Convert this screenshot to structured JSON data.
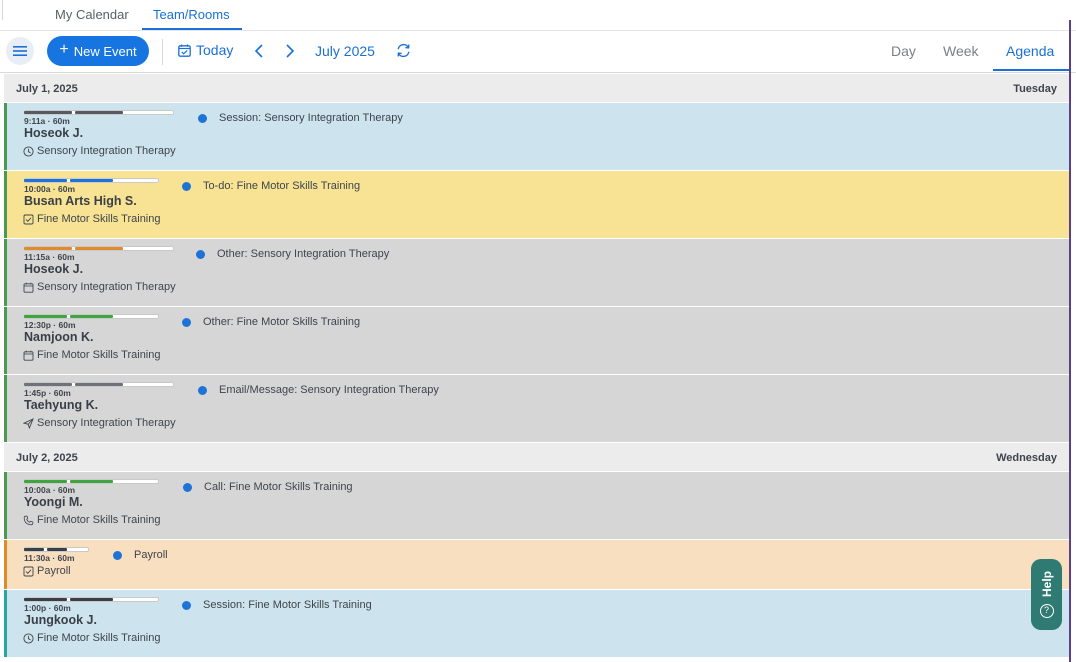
{
  "top_tabs": {
    "my_calendar": "My Calendar",
    "team_rooms": "Team/Rooms"
  },
  "toolbar": {
    "new_event": "New Event",
    "today": "Today",
    "month": "July 2025",
    "views": {
      "day": "Day",
      "week": "Week",
      "agenda": "Agenda"
    }
  },
  "days": [
    {
      "date": "July 1, 2025",
      "weekday": "Tuesday",
      "events": [
        {
          "time": "9:11a · 60m",
          "name": "Hoseok J.",
          "sub": "Sensory Integration Therapy",
          "title": "Session: Sensory Integration Therapy",
          "icon": "clock-icon",
          "bg": "#cde4ee",
          "border": "#4a9a52",
          "bar_color": "#555a63"
        },
        {
          "time": "10:00a · 60m",
          "name": "Busan Arts High S.",
          "sub": "Fine Motor Skills Training",
          "title": "To-do: Fine Motor Skills Training",
          "icon": "checkbox-icon",
          "bg": "#f7e393",
          "border": "#4a9a52",
          "bar_color": "#1e74d6"
        },
        {
          "time": "11:15a · 60m",
          "name": "Hoseok J.",
          "sub": "Sensory Integration Therapy",
          "title": "Other: Sensory Integration Therapy",
          "icon": "calendar-icon",
          "bg": "#d6d6d6",
          "border": "#4a9a52",
          "bar_color": "#e08a2c"
        },
        {
          "time": "12:30p · 60m",
          "name": "Namjoon K.",
          "sub": "Fine Motor Skills Training",
          "title": "Other: Fine Motor Skills Training",
          "icon": "calendar-icon",
          "bg": "#d6d6d6",
          "border": "#4a9a52",
          "bar_color": "#3fa63f"
        },
        {
          "time": "1:45p · 60m",
          "name": "Taehyung K.",
          "sub": "Sensory Integration Therapy",
          "title": "Email/Message: Sensory Integration Therapy",
          "icon": "send-icon",
          "bg": "#d6d6d6",
          "border": "#4a9a52",
          "bar_color": "#6e737b"
        }
      ]
    },
    {
      "date": "July 2, 2025",
      "weekday": "Wednesday",
      "events": [
        {
          "time": "10:00a · 60m",
          "name": "Yoongi M.",
          "sub": "Fine Motor Skills Training",
          "title": "Call: Fine Motor Skills Training",
          "icon": "phone-icon",
          "bg": "#d6d6d6",
          "border": "#4a9a52",
          "bar_color": "#3fa63f"
        },
        {
          "time": "11:30a · 60m",
          "name": "",
          "sub": "Payroll",
          "title": "Payroll",
          "icon": "checkbox-icon",
          "bg": "#f7dfc0",
          "border": "#e08a2c",
          "bar_color": "#3a3f47"
        },
        {
          "time": "1:00p · 60m",
          "name": "Jungkook J.",
          "sub": "Fine Motor Skills Training",
          "title": "Session: Fine Motor Skills Training",
          "icon": "clock-icon",
          "bg": "#cde4ee",
          "border": "#2aa6a0",
          "bar_color": "#3a3f47"
        }
      ]
    }
  ],
  "help": "Help"
}
